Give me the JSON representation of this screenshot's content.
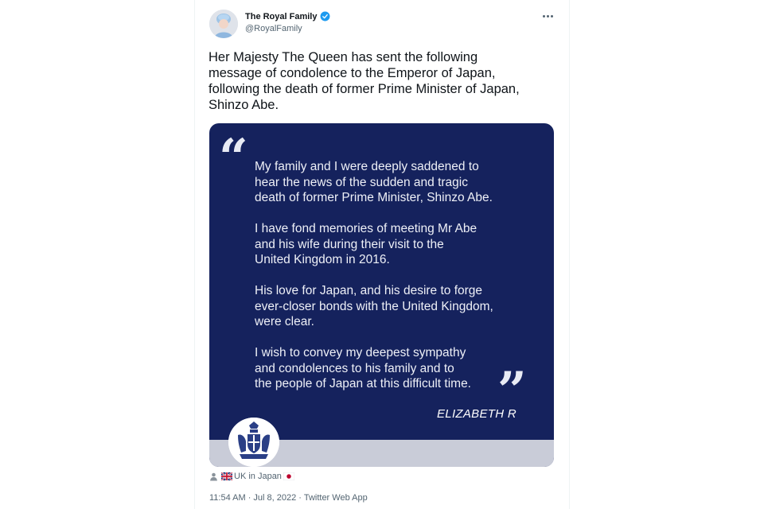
{
  "account": {
    "name": "The Royal Family",
    "handle": "@RoyalFamily"
  },
  "tweet": {
    "text": "Her Majesty The Queen has sent the following\nmessage of condolence to the Emperor of Japan,\nfollowing the death of former Prime Minister of Japan,\nShinzo Abe."
  },
  "image_card": {
    "paragraphs": [
      "My family and I were deeply saddened to\nhear the news of the sudden and tragic\ndeath of former Prime Minister, Shinzo Abe.",
      "I have fond memories of meeting Mr Abe\nand his wife during their visit to the\nUnited Kingdom in 2016.",
      "His love for Japan, and his desire to forge\never-closer bonds with the United Kingdom,\nwere clear.",
      "I wish to convey my deepest sympathy\nand condolences to his family and to\nthe people of Japan at this difficult time."
    ],
    "signature": "ELIZABETH R",
    "quote_open": "“",
    "quote_close": "”",
    "colors": {
      "background": "#15225d",
      "footer": "#c9ccd8",
      "text": "#eef0f7"
    }
  },
  "location": {
    "text": "UK in Japan",
    "icons": [
      "person-icon",
      "uk-flag-icon",
      "japan-flag-icon"
    ]
  },
  "timestamp": "11:54 AM · Jul 8, 2022 · Twitter Web App",
  "colors": {
    "verified": "#1d9bf0",
    "secondary_text": "#536471"
  }
}
